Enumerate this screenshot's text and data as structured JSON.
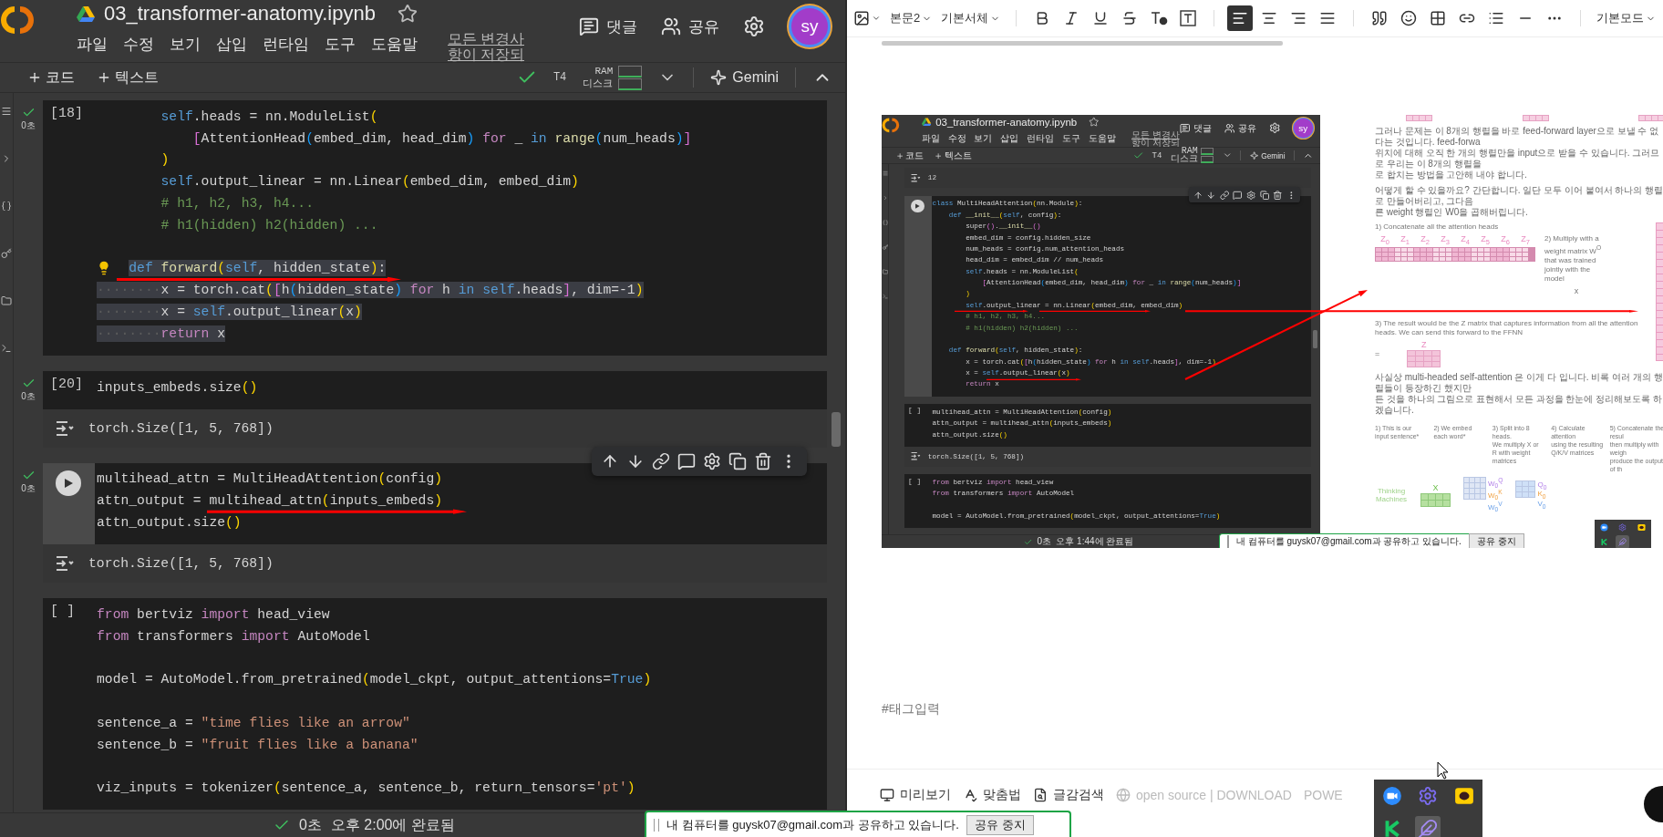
{
  "colab": {
    "title": "03_transformer-anatomy.ipynb",
    "menu": [
      "파일",
      "수정",
      "보기",
      "삽입",
      "런타임",
      "도구",
      "도움말"
    ],
    "save_status": [
      "모든 변경사",
      "항이 저장되"
    ],
    "actions": [
      {
        "kind": "comment",
        "label": "댓글"
      },
      {
        "kind": "share",
        "label": "공유"
      }
    ],
    "avatar": "sy",
    "toolbar": {
      "add": [
        "코드",
        "텍스트"
      ],
      "connected": true,
      "runtime": "T4",
      "ram": "RAM",
      "disk": "디스크",
      "gemini": "Gemini"
    },
    "cells": [
      {
        "kind": "code",
        "prompt": "[18]",
        "ran": true,
        "time": "0초",
        "active": false,
        "toolbar": false,
        "lines": [
          {
            "selected": false,
            "t": [
              {
                "text": "        self",
                "kind": "blue"
              },
              {
                "text": ".heads = nn.ModuleList",
                "kind": "plain"
              },
              {
                "text": "(",
                "kind": "paren"
              }
            ]
          },
          {
            "selected": false,
            "t": [
              {
                "text": "            [",
                "kind": "bracket"
              },
              {
                "text": "AttentionHead",
                "kind": "plain"
              },
              {
                "text": "(",
                "kind": "inner"
              },
              {
                "text": "embed_dim, head_dim",
                "kind": "plain"
              },
              {
                "text": ")",
                "kind": "inner"
              },
              {
                "text": " for",
                "kind": "keyword"
              },
              {
                "text": " _ ",
                "kind": "plain"
              },
              {
                "text": "in",
                "kind": "blue"
              },
              {
                "text": " range",
                "kind": "function"
              },
              {
                "text": "(",
                "kind": "inner"
              },
              {
                "text": "num_heads",
                "kind": "plain"
              },
              {
                "text": ")",
                "kind": "inner"
              },
              {
                "text": "]",
                "kind": "bracket"
              }
            ]
          },
          {
            "selected": false,
            "t": [
              {
                "text": "        )",
                "kind": "paren"
              }
            ]
          },
          {
            "selected": false,
            "t": [
              {
                "text": "        self",
                "kind": "blue"
              },
              {
                "text": ".output_linear = nn.Linear",
                "kind": "plain"
              },
              {
                "text": "(",
                "kind": "paren"
              },
              {
                "text": "embed_dim, embed_dim",
                "kind": "plain"
              },
              {
                "text": ")",
                "kind": "paren"
              }
            ]
          },
          {
            "selected": false,
            "t": [
              {
                "text": "        # h1, h2, h3, h4...",
                "kind": "comment"
              }
            ]
          },
          {
            "selected": false,
            "t": [
              {
                "text": "        # h1(hidden) h2(hidden) ...",
                "kind": "comment"
              }
            ]
          },
          {
            "blank": true
          },
          {
            "selected": true,
            "bulb": true,
            "t": [
              {
                "text": "def",
                "kind": "blue"
              },
              {
                "text": " forward",
                "kind": "function"
              },
              {
                "text": "(",
                "kind": "paren"
              },
              {
                "text": "self",
                "kind": "blue"
              },
              {
                "text": ", hidden_state",
                "kind": "plain"
              },
              {
                "text": ")",
                "kind": "paren"
              },
              {
                "text": ":",
                "kind": "plain"
              }
            ]
          },
          {
            "selected": true,
            "t": [
              {
                "text": "········",
                "kind": "whitespace"
              },
              {
                "text": "x = torch.cat",
                "kind": "plain"
              },
              {
                "text": "(",
                "kind": "paren"
              },
              {
                "text": "[",
                "kind": "bracket"
              },
              {
                "text": "h",
                "kind": "plain"
              },
              {
                "text": "(",
                "kind": "inner"
              },
              {
                "text": "hidden_state",
                "kind": "plain"
              },
              {
                "text": ")",
                "kind": "inner"
              },
              {
                "text": " for",
                "kind": "keyword"
              },
              {
                "text": " h ",
                "kind": "plain"
              },
              {
                "text": "in self",
                "kind": "blue"
              },
              {
                "text": ".heads",
                "kind": "plain"
              },
              {
                "text": "]",
                "kind": "bracket"
              },
              {
                "text": ", dim=-1",
                "kind": "plain"
              },
              {
                "text": ")",
                "kind": "paren"
              }
            ]
          },
          {
            "selected": true,
            "t": [
              {
                "text": "········",
                "kind": "whitespace"
              },
              {
                "text": "x = ",
                "kind": "plain"
              },
              {
                "text": "self",
                "kind": "blue"
              },
              {
                "text": ".output_linear",
                "kind": "plain"
              },
              {
                "text": "(",
                "kind": "paren"
              },
              {
                "text": "x",
                "kind": "plain"
              },
              {
                "text": ")",
                "kind": "paren"
              }
            ]
          },
          {
            "selected": true,
            "t": [
              {
                "text": "········",
                "kind": "whitespace"
              },
              {
                "text": "return",
                "kind": "keyword"
              },
              {
                "text": " x",
                "kind": "plain"
              }
            ]
          }
        ]
      },
      {
        "kind": "code",
        "prompt": "[20]",
        "ran": true,
        "time": "0초",
        "active": false,
        "toolbar": false,
        "lines": [
          {
            "t": [
              {
                "text": "inputs_embeds.size",
                "kind": "plain"
              },
              {
                "text": "()",
                "kind": "paren"
              }
            ]
          }
        ],
        "output": "torch.Size([1, 5, 768])"
      },
      {
        "kind": "code",
        "ran": true,
        "time": "0초",
        "active": true,
        "toolbar": true,
        "lines": [
          {
            "t": [
              {
                "text": "multihead_attn = MultiHeadAttention",
                "kind": "plain"
              },
              {
                "text": "(",
                "kind": "paren"
              },
              {
                "text": "config",
                "kind": "plain"
              },
              {
                "text": ")",
                "kind": "paren"
              }
            ]
          },
          {
            "t": [
              {
                "text": "attn_output = multihead_attn",
                "kind": "plain"
              },
              {
                "text": "(",
                "kind": "paren"
              },
              {
                "text": "inputs_embeds",
                "kind": "plain"
              },
              {
                "text": ")",
                "kind": "paren"
              }
            ]
          },
          {
            "t": [
              {
                "text": "attn_output.size",
                "kind": "plain"
              },
              {
                "text": "()",
                "kind": "paren"
              }
            ]
          }
        ],
        "output": "torch.Size([1, 5, 768])"
      },
      {
        "kind": "code",
        "prompt": "[ ]",
        "ran": false,
        "active": false,
        "toolbar": false,
        "lines": [
          {
            "t": [
              {
                "text": "from",
                "kind": "keyword"
              },
              {
                "text": " bertviz ",
                "kind": "plain"
              },
              {
                "text": "import",
                "kind": "keyword"
              },
              {
                "text": " head_view",
                "kind": "plain"
              }
            ]
          },
          {
            "t": [
              {
                "text": "from",
                "kind": "keyword"
              },
              {
                "text": " transformers ",
                "kind": "plain"
              },
              {
                "text": "import",
                "kind": "keyword"
              },
              {
                "text": " AutoModel",
                "kind": "plain"
              }
            ]
          },
          {
            "blank": true
          },
          {
            "t": [
              {
                "text": "model = AutoModel.from_pretrained",
                "kind": "plain"
              },
              {
                "text": "(",
                "kind": "paren"
              },
              {
                "text": "model_ckpt, output_attentions=",
                "kind": "plain"
              },
              {
                "text": "True",
                "kind": "blue"
              },
              {
                "text": ")",
                "kind": "paren"
              }
            ]
          },
          {
            "blank": true
          },
          {
            "t": [
              {
                "text": "sentence_a = ",
                "kind": "plain"
              },
              {
                "text": "\"time flies like an arrow\"",
                "kind": "string"
              }
            ]
          },
          {
            "t": [
              {
                "text": "sentence_b = ",
                "kind": "plain"
              },
              {
                "text": "\"fruit flies like a banana\"",
                "kind": "string"
              }
            ]
          },
          {
            "blank": true
          },
          {
            "t": [
              {
                "text": "viz_inputs = tokenizer",
                "kind": "plain"
              },
              {
                "text": "(",
                "kind": "paren"
              },
              {
                "text": "sentence_a, sentence_b, return_tensors=",
                "kind": "plain"
              },
              {
                "text": "'pt'",
                "kind": "string"
              },
              {
                "text": ")",
                "kind": "paren"
              }
            ]
          }
        ]
      }
    ],
    "status": {
      "done": true,
      "duration": "0초",
      "message": "오후 2:00에 완료됨"
    }
  },
  "editor": {
    "toolbar": [
      {
        "kind": "image"
      },
      {
        "kind": "dropdown",
        "label": "본문2"
      },
      {
        "kind": "dropdown",
        "label": "기본서체"
      },
      {
        "kind": "sep"
      },
      {
        "kind": "bold"
      },
      {
        "kind": "italic"
      },
      {
        "kind": "underline"
      },
      {
        "kind": "strike"
      },
      {
        "kind": "text-color"
      },
      {
        "kind": "highlight"
      },
      {
        "kind": "sep"
      },
      {
        "kind": "align-left",
        "selected": true
      },
      {
        "kind": "align-center",
        "selected": false
      },
      {
        "kind": "align-right",
        "selected": false
      },
      {
        "kind": "align-justify",
        "selected": false
      },
      {
        "kind": "sep"
      },
      {
        "kind": "quote"
      },
      {
        "kind": "emoji"
      },
      {
        "kind": "table"
      },
      {
        "kind": "link"
      },
      {
        "kind": "list"
      },
      {
        "kind": "divider"
      },
      {
        "kind": "more"
      },
      {
        "kind": "sep"
      },
      {
        "kind": "dropdown",
        "label": "기본모드"
      }
    ],
    "embedded_screenshot": {
      "colab": {
        "title": "03_transformer-anatomy.ipynb",
        "menu": [
          "파일",
          "수정",
          "보기",
          "삽입",
          "런타임",
          "도구",
          "도움말"
        ],
        "save_status": [
          "모든 변경사",
          "항이 저장되"
        ],
        "actions": [
          {
            "kind": "comment",
            "label": "댓글"
          },
          {
            "kind": "share",
            "label": "공유"
          }
        ],
        "avatar": "sy",
        "toolbar": {
          "add": [
            "코드",
            "텍스트"
          ],
          "connected": true,
          "runtime": "T4",
          "ram": "RAM",
          "disk": "디스크",
          "gemini": "Gemini"
        },
        "cells": [
          {
            "kind": "output",
            "text": "12"
          },
          {
            "kind": "code",
            "ran": false,
            "active": true,
            "toolbar": true,
            "lines": [
              {
                "t": [
                  {
                    "text": "class",
                    "kind": "blue"
                  },
                  {
                    "text": " MultiHeadAttention",
                    "kind": "plain"
                  },
                  {
                    "text": "(",
                    "kind": "paren"
                  },
                  {
                    "text": "nn.Module",
                    "kind": "plain"
                  },
                  {
                    "text": ")",
                    "kind": "paren"
                  },
                  {
                    "text": ":",
                    "kind": "plain"
                  }
                ]
              },
              {
                "t": [
                  {
                    "text": "    def",
                    "kind": "blue"
                  },
                  {
                    "text": " __init__",
                    "kind": "function"
                  },
                  {
                    "text": "(",
                    "kind": "paren"
                  },
                  {
                    "text": "self",
                    "kind": "blue"
                  },
                  {
                    "text": ", config",
                    "kind": "plain"
                  },
                  {
                    "text": ")",
                    "kind": "paren"
                  },
                  {
                    "text": ":",
                    "kind": "plain"
                  }
                ]
              },
              {
                "t": [
                  {
                    "text": "        super",
                    "kind": "plain"
                  },
                  {
                    "text": "()",
                    "kind": "bracket"
                  },
                  {
                    "text": ".",
                    "kind": "plain"
                  },
                  {
                    "text": "__init__",
                    "kind": "function"
                  },
                  {
                    "text": "()",
                    "kind": "bracket"
                  }
                ]
              },
              {
                "t": [
                  {
                    "text": "        embed_dim = config.hidden_size",
                    "kind": "plain"
                  }
                ]
              },
              {
                "t": [
                  {
                    "text": "        num_heads = config.num_attention_heads",
                    "kind": "plain"
                  }
                ]
              },
              {
                "t": [
                  {
                    "text": "        head_dim = embed_dim // num_heads",
                    "kind": "plain"
                  }
                ]
              },
              {
                "t": [
                  {
                    "text": "        self",
                    "kind": "blue"
                  },
                  {
                    "text": ".heads = nn.ModuleList",
                    "kind": "plain"
                  },
                  {
                    "text": "(",
                    "kind": "paren"
                  }
                ]
              },
              {
                "t": [
                  {
                    "text": "            [",
                    "kind": "bracket"
                  },
                  {
                    "text": "AttentionHead",
                    "kind": "plain"
                  },
                  {
                    "text": "(",
                    "kind": "inner"
                  },
                  {
                    "text": "embed_dim, head_dim",
                    "kind": "plain"
                  },
                  {
                    "text": ")",
                    "kind": "inner"
                  },
                  {
                    "text": " for",
                    "kind": "keyword"
                  },
                  {
                    "text": " _ ",
                    "kind": "plain"
                  },
                  {
                    "text": "in",
                    "kind": "blue"
                  },
                  {
                    "text": " range",
                    "kind": "function"
                  },
                  {
                    "text": "(",
                    "kind": "inner"
                  },
                  {
                    "text": "num_heads",
                    "kind": "plain"
                  },
                  {
                    "text": ")",
                    "kind": "inner"
                  },
                  {
                    "text": "]",
                    "kind": "bracket"
                  }
                ]
              },
              {
                "t": [
                  {
                    "text": "        )",
                    "kind": "paren"
                  }
                ]
              },
              {
                "t": [
                  {
                    "text": "        self",
                    "kind": "blue"
                  },
                  {
                    "text": ".output_linear = nn.Linear",
                    "kind": "plain"
                  },
                  {
                    "text": "(",
                    "kind": "paren"
                  },
                  {
                    "text": "embed_dim, embed_dim",
                    "kind": "plain"
                  },
                  {
                    "text": ")",
                    "kind": "paren"
                  }
                ]
              },
              {
                "t": [
                  {
                    "text": "        # h1, h2, h3, h4...",
                    "kind": "comment"
                  }
                ]
              },
              {
                "t": [
                  {
                    "text": "        # h1(hidden) h2(hidden) ...",
                    "kind": "comment"
                  }
                ]
              },
              {
                "blank": true
              },
              {
                "t": [
                  {
                    "text": "    def",
                    "kind": "blue"
                  },
                  {
                    "text": " forward",
                    "kind": "function"
                  },
                  {
                    "text": "(",
                    "kind": "paren"
                  },
                  {
                    "text": "self",
                    "kind": "blue"
                  },
                  {
                    "text": ", hidden_state",
                    "kind": "plain"
                  },
                  {
                    "text": ")",
                    "kind": "paren"
                  },
                  {
                    "text": ":",
                    "kind": "plain"
                  }
                ]
              },
              {
                "t": [
                  {
                    "text": "        x = torch.cat",
                    "kind": "plain"
                  },
                  {
                    "text": "(",
                    "kind": "paren"
                  },
                  {
                    "text": "[",
                    "kind": "bracket"
                  },
                  {
                    "text": "h",
                    "kind": "plain"
                  },
                  {
                    "text": "(",
                    "kind": "inner"
                  },
                  {
                    "text": "hidden_state",
                    "kind": "plain"
                  },
                  {
                    "text": ")",
                    "kind": "inner"
                  },
                  {
                    "text": " for",
                    "kind": "keyword"
                  },
                  {
                    "text": " h ",
                    "kind": "plain"
                  },
                  {
                    "text": "in self",
                    "kind": "blue"
                  },
                  {
                    "text": ".heads",
                    "kind": "plain"
                  },
                  {
                    "text": "]",
                    "kind": "bracket"
                  },
                  {
                    "text": ", dim=-1",
                    "kind": "plain"
                  },
                  {
                    "text": ")",
                    "kind": "paren"
                  }
                ]
              },
              {
                "t": [
                  {
                    "text": "        x = ",
                    "kind": "plain"
                  },
                  {
                    "text": "self",
                    "kind": "blue"
                  },
                  {
                    "text": ".output_linear",
                    "kind": "plain"
                  },
                  {
                    "text": "(",
                    "kind": "paren"
                  },
                  {
                    "text": "x",
                    "kind": "plain"
                  },
                  {
                    "text": ")",
                    "kind": "paren"
                  }
                ]
              },
              {
                "t": [
                  {
                    "text": "        return",
                    "kind": "keyword"
                  },
                  {
                    "text": " x",
                    "kind": "plain"
                  }
                ]
              }
            ]
          },
          {
            "kind": "code",
            "prompt": "[ ]",
            "ran": false,
            "active": false,
            "toolbar": false,
            "lines": [
              {
                "t": [
                  {
                    "text": "multihead_attn = MultiHeadAttention",
                    "kind": "plain"
                  },
                  {
                    "text": "(",
                    "kind": "paren"
                  },
                  {
                    "text": "config",
                    "kind": "plain"
                  },
                  {
                    "text": ")",
                    "kind": "paren"
                  }
                ]
              },
              {
                "t": [
                  {
                    "text": "attn_output = multihead_attn",
                    "kind": "plain"
                  },
                  {
                    "text": "(",
                    "kind": "paren"
                  },
                  {
                    "text": "inputs_embeds",
                    "kind": "plain"
                  },
                  {
                    "text": ")",
                    "kind": "paren"
                  }
                ]
              },
              {
                "t": [
                  {
                    "text": "attn_output.size",
                    "kind": "plain"
                  },
                  {
                    "text": "()",
                    "kind": "paren"
                  }
                ]
              }
            ],
            "output": "torch.Size([1, 5, 768])"
          },
          {
            "kind": "code",
            "prompt": "[ ]",
            "ran": false,
            "active": false,
            "toolbar": false,
            "lines": [
              {
                "t": [
                  {
                    "text": "from",
                    "kind": "keyword"
                  },
                  {
                    "text": " bertviz ",
                    "kind": "plain"
                  },
                  {
                    "text": "import",
                    "kind": "keyword"
                  },
                  {
                    "text": " head_view",
                    "kind": "plain"
                  }
                ]
              },
              {
                "t": [
                  {
                    "text": "from",
                    "kind": "keyword"
                  },
                  {
                    "text": " transformers ",
                    "kind": "plain"
                  },
                  {
                    "text": "import",
                    "kind": "keyword"
                  },
                  {
                    "text": " AutoModel",
                    "kind": "plain"
                  }
                ]
              },
              {
                "blank": true
              },
              {
                "t": [
                  {
                    "text": "model = AutoModel.from_pretrained",
                    "kind": "plain"
                  },
                  {
                    "text": "(",
                    "kind": "paren"
                  },
                  {
                    "text": "model_ckpt, output_attentions=",
                    "kind": "plain"
                  },
                  {
                    "text": "True",
                    "kind": "blue"
                  },
                  {
                    "text": ")",
                    "kind": "paren"
                  }
                ]
              }
            ]
          }
        ],
        "status": {
          "done": true,
          "duration": "0초",
          "message": "오후 1:44에 완료됨"
        }
      },
      "article": {
        "blocks": [
          {
            "kind": "matrices"
          },
          {
            "kind": "paragraph",
            "lines": [
              "그러나 문제는 이 8개의 행렬을 바로 feed-forward layer으로 보낼 수 없다는 것입니다. feed-forwa",
              "위치에 대해 오직 한 개의 행렬만을 input으로 받을 수 있습니다. 그러므로 우리는 이 8개의 행렬을",
              "로 합치는 방법을 고안해 내야 합니다."
            ]
          },
          {
            "kind": "paragraph",
            "lines": [
              "어떻게 할 수 있을까요? 간단합니다. 일단 모두 이어 붙여서 하나의 행렬로 만들어버리고, 그다음",
              "른 weight 행렬인 W0을 곱해버립니다."
            ]
          },
          {
            "kind": "concat",
            "step1": "1) Concatenate all the attention heads",
            "heads": [
              "Z$_{0}$",
              "Z$_{1}$",
              "Z$_{2}$",
              "Z$_{3}$",
              "Z$_{4}$",
              "Z$_{5}$",
              "Z$_{6}$",
              "Z$_{7}$"
            ],
            "step2": "2) Multiply with a weight matrix W$^{O}$ that was trained jointly with the model",
            "times": "x",
            "step3": "3) The result would be the Z matrix that captures information from all the attention heads. We can send this forward to the FFNN",
            "equals": "=",
            "result": "Z"
          },
          {
            "kind": "paragraph",
            "lines": [
              "사실상 multi-headed self-attention 은 이게 다 입니다. 비록 여러 개의 행렬들이 등장하긴 했지만",
              "든 것을 하나의 그림으로 표현해서 모든 과정을 한눈에 정리해보도록 하겠습니다."
            ]
          },
          {
            "kind": "overview",
            "steps": [
              [
                "1) This is our",
                "input sentence*"
              ],
              [
                "2) We embed",
                "each word*"
              ],
              [
                "3) Split into 8 heads.",
                "We multiply X or",
                "R with weight matrices"
              ],
              [
                "4) Calculate attention",
                "using the resulting",
                "Q/K/V matrices"
              ],
              [
                "5) Concatenate the resul",
                "then multiply with weigh",
                "produce the output of th"
              ]
            ],
            "sentence": "Thinking Machines",
            "embedding": "X",
            "weights": [
              "W$_{0}$$^{Q}$",
              "W$_{0}$$^{K}$",
              "W$_{0}$$^{V}$"
            ],
            "qkv": [
              "Q$_{0}$",
              "K$_{0}$",
              "V$_{0}$"
            ]
          }
        ]
      },
      "share_bar": {
        "message": "내 컴퓨터를 guysk07@gmail.com과 공유하고 있습니다.",
        "button": "공유 중지"
      },
      "dock": [
        {
          "kind": "video",
          "selected": false
        },
        {
          "kind": "gear",
          "selected": false
        },
        {
          "kind": "chat",
          "selected": false
        },
        {
          "kind": "k",
          "selected": false
        },
        {
          "kind": "feather",
          "selected": true
        }
      ]
    },
    "tag_field": {
      "placeholder": "#태그입력"
    },
    "bottom_bar": [
      {
        "kind": "preview",
        "label": "미리보기"
      },
      {
        "kind": "spellcheck",
        "label": "맞춤법"
      },
      {
        "kind": "material",
        "label": "글감검색"
      },
      {
        "kind": "opensource",
        "label": "open source | DOWNLOAD"
      },
      {
        "kind": "plain",
        "label": "POWE"
      }
    ]
  },
  "share_bar": {
    "message": "내 컴퓨터를 guysk07@gmail.com과 공유하고 있습니다.",
    "button": "공유 중지"
  },
  "dock": [
    {
      "kind": "video",
      "selected": false
    },
    {
      "kind": "gear",
      "selected": false
    },
    {
      "kind": "chat",
      "selected": false
    },
    {
      "kind": "k",
      "selected": false
    },
    {
      "kind": "feather",
      "selected": true
    }
  ]
}
